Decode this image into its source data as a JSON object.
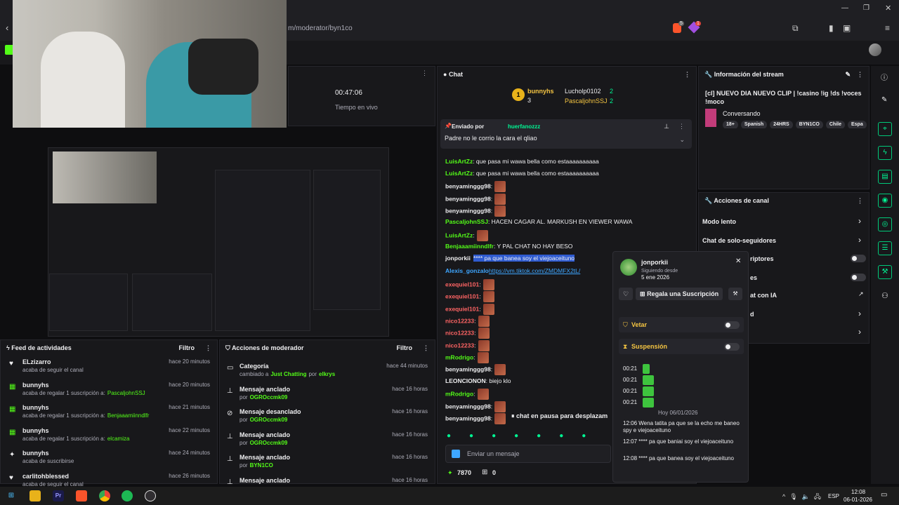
{
  "browser": {
    "url": "m/moderator/byn1co",
    "badge_count_1": "5",
    "badge_count_2": "1"
  },
  "stats": {
    "time": "00:47:06",
    "time_label": "Tiempo en vivo"
  },
  "chat": {
    "title": "Chat",
    "leaderboard": {
      "top_name": "bunnyhs",
      "top_count": "3",
      "second_name": "Lucholp0102",
      "second_count": "2",
      "third_name": "PascaljohnSSJ",
      "third_count": "2"
    },
    "pinned": {
      "label": "Enviado por",
      "user": "huerfanozzz",
      "message": "Padre no le corrio la cara el qliao"
    },
    "messages": [
      {
        "user": "LuisArtZz",
        "text": ": que pasa mi wawa bella como estaaaaaaaaaa",
        "color": "green"
      },
      {
        "user": "LuisArtZz",
        "text": ": que pasa mi wawa bella como estaaaaaaaaaa",
        "color": "green"
      },
      {
        "user": "benyaminggg98",
        "text": ":",
        "color": "white"
      },
      {
        "user": "benyaminggg98",
        "text": ":",
        "color": "white"
      },
      {
        "user": "benyaminggg98",
        "text": ":",
        "color": "white"
      },
      {
        "user": "PascaljohnSSJ",
        "text": ": HACEN CAGAR AL. MARKUSH EN VIEWER WAWA",
        "color": "green"
      },
      {
        "user": "LuisArtZz",
        "text": ":",
        "color": "green"
      },
      {
        "user": "Benjaaamiinndlfr",
        "text": ": Y PAL CHAT NO HAY BESO",
        "color": "green"
      },
      {
        "user": "jonporkii",
        "text": "**** pa que banea soy el viejoaceituno",
        "color": "white"
      },
      {
        "user": "Alexis_gonzalo",
        "text": "https://vm.tiktok.com/ZMDMFX2tL/",
        "color": "blue"
      },
      {
        "user": "exequiel101",
        "text": ":",
        "color": "red"
      },
      {
        "user": "exequiel101",
        "text": ":",
        "color": "red"
      },
      {
        "user": "exequiel101",
        "text": ":",
        "color": "red"
      },
      {
        "user": "nico12233",
        "text": ":",
        "color": "red"
      },
      {
        "user": "nico12233",
        "text": ":",
        "color": "red"
      },
      {
        "user": "nico12233",
        "text": ":",
        "color": "red"
      },
      {
        "user": "mRodrigo",
        "text": ":",
        "color": "green"
      },
      {
        "user": "benyaminggg98",
        "text": ":",
        "color": "white"
      },
      {
        "user": "LEONCIONON",
        "text": ": biejo klo",
        "color": "white"
      },
      {
        "user": "mRodrigo",
        "text": ":",
        "color": "green"
      },
      {
        "user": "benyaminggg98",
        "text": ":",
        "color": "white"
      },
      {
        "user": "benyaminggg98",
        "text": ":",
        "color": "white"
      }
    ],
    "paused": "chat en pausa para desplazam",
    "input_placeholder": "Enviar un mensaje",
    "points": "7870",
    "gifts": "0"
  },
  "stream_info": {
    "title": "Información del stream",
    "stream_title": "[cl] NUEVO DIA NUEVO CLIP | !casino !ig !ds !voces !moco",
    "category": "Conversando",
    "tags": [
      "18+",
      "Spanish",
      "24HRS",
      "BYN1CO",
      "Chile",
      "Espa"
    ]
  },
  "channel_actions": {
    "title": "Acciones de canal",
    "items": [
      "Modo lento",
      "Chat de solo-seguidores",
      "riptores",
      "es",
      "at con IA",
      "d",
      ""
    ]
  },
  "user_card": {
    "username": "jonporkii",
    "follow_label": "Siguiendo desde",
    "follow_date": "5 ene 2026",
    "gift_button": "Regala una Suscripción",
    "ban_label": "Vetar",
    "timeout_label": "Suspensión",
    "history": [
      {
        "time": "00:21",
        "text": ""
      },
      {
        "time": "00:21",
        "text": ""
      },
      {
        "time": "00:21",
        "text": ""
      },
      {
        "time": "00:21",
        "text": ""
      }
    ],
    "today_label": "Hoy 06/01/2026",
    "today_messages": [
      {
        "time": "12:06",
        "text": "Wena tatita pa que se la echo me baneo spy e viejoaceituno"
      },
      {
        "time": "12:07",
        "text": "**** pa que baniai soy el viejoaceituno"
      },
      {
        "time": "12:08",
        "text": "**** pa que banea soy el viejoaceituno"
      }
    ]
  },
  "activity": {
    "title": "Feed de actividades",
    "filter": "Filtro",
    "items": [
      {
        "name": "ELzizarro",
        "action": "acaba de seguir el canal",
        "time": "hace 20 minutos",
        "target": ""
      },
      {
        "name": "bunnyhs",
        "action": "acaba de regalar 1 suscripción a:",
        "time": "hace 20 minutos",
        "target": "PascaljohnSSJ"
      },
      {
        "name": "bunnyhs",
        "action": "acaba de regalar 1 suscripción a:",
        "time": "hace 21 minutos",
        "target": "Benjaaamiinndlfr"
      },
      {
        "name": "bunnyhs",
        "action": "acaba de regalar 1 suscripción a:",
        "time": "hace 22 minutos",
        "target": "elcamiza"
      },
      {
        "name": "bunnyhs",
        "action": "acaba de suscribirse",
        "time": "hace 24 minutos",
        "target": ""
      },
      {
        "name": "carlitohblessed",
        "action": "acaba de seguir el canal",
        "time": "hace 26 minutos",
        "target": ""
      }
    ]
  },
  "mod_actions": {
    "title": "Acciones de moderador",
    "filter": "Filtro",
    "items": [
      {
        "title": "Categoría",
        "sub": "cambiado a",
        "target": "Just Chatting",
        "by": "por",
        "who": "elkrys",
        "time": "hace 44 minutos"
      },
      {
        "title": "Mensaje anclado",
        "sub": "por",
        "target": "OGROccmk09",
        "by": "",
        "who": "",
        "time": "hace 16 horas"
      },
      {
        "title": "Mensaje desanclado",
        "sub": "por",
        "target": "OGROccmk09",
        "by": "",
        "who": "",
        "time": "hace 16 horas"
      },
      {
        "title": "Mensaje anclado",
        "sub": "por",
        "target": "OGROccmk09",
        "by": "",
        "who": "",
        "time": "hace 16 horas"
      },
      {
        "title": "Mensaje anclado",
        "sub": "por",
        "target": "BYN1CO",
        "by": "",
        "who": "",
        "time": "hace 16 horas"
      },
      {
        "title": "Mensaje anclado",
        "sub": "",
        "target": "",
        "by": "",
        "who": "",
        "time": "hace 16 horas"
      }
    ]
  },
  "taskbar": {
    "lang": "ESP",
    "time": "12:08",
    "date": "06-01-2026"
  }
}
